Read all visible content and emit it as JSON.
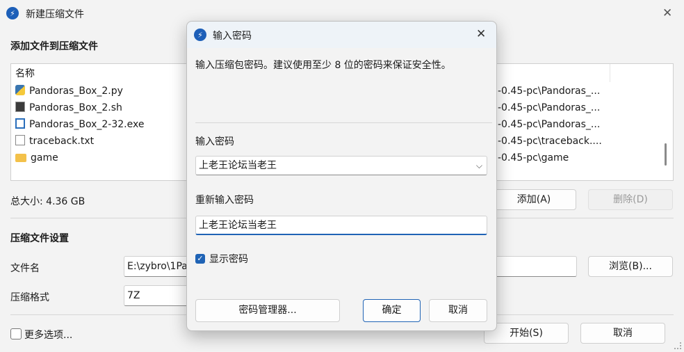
{
  "window": {
    "title": "新建压缩文件",
    "close_icon": "✕"
  },
  "files_section": {
    "heading": "添加文件到压缩文件",
    "column_name": "名称",
    "items": [
      {
        "name": "Pandoras_Box_2.py",
        "icon": "python-file-icon",
        "path": "-0.45-pc\\Pandoras_..."
      },
      {
        "name": "Pandoras_Box_2.sh",
        "icon": "script-file-icon",
        "path": "-0.45-pc\\Pandoras_..."
      },
      {
        "name": "Pandoras_Box_2-32.exe",
        "icon": "exe-file-icon",
        "path": "-0.45-pc\\Pandoras_..."
      },
      {
        "name": "traceback.txt",
        "icon": "text-file-icon",
        "path": "-0.45-pc\\traceback...."
      },
      {
        "name": "game",
        "icon": "folder-icon",
        "path": "-0.45-pc\\game"
      }
    ],
    "total_size": "总大小: 4.36 GB",
    "add_button": "添加(A)",
    "delete_button": "删除(D)"
  },
  "settings": {
    "heading": "压缩文件设置",
    "filename_label": "文件名",
    "filename_value": "E:\\zybro\\1Pa",
    "browse_button": "浏览(B)...",
    "format_label": "压缩格式",
    "format_value": "7Z",
    "more_options": "更多选项...",
    "start_button": "开始(S)",
    "cancel_button": "取消"
  },
  "dialog": {
    "title": "输入密码",
    "description": "输入压缩包密码。建议使用至少 8 位的密码来保证安全性。",
    "password_label": "输入密码",
    "password_value": "上老王论坛当老王",
    "confirm_label": "重新输入密码",
    "confirm_value": "上老王论坛当老王",
    "show_password": "显示密码",
    "show_password_checked": true,
    "manager_button": "密码管理器...",
    "ok_button": "确定",
    "cancel_button": "取消"
  }
}
